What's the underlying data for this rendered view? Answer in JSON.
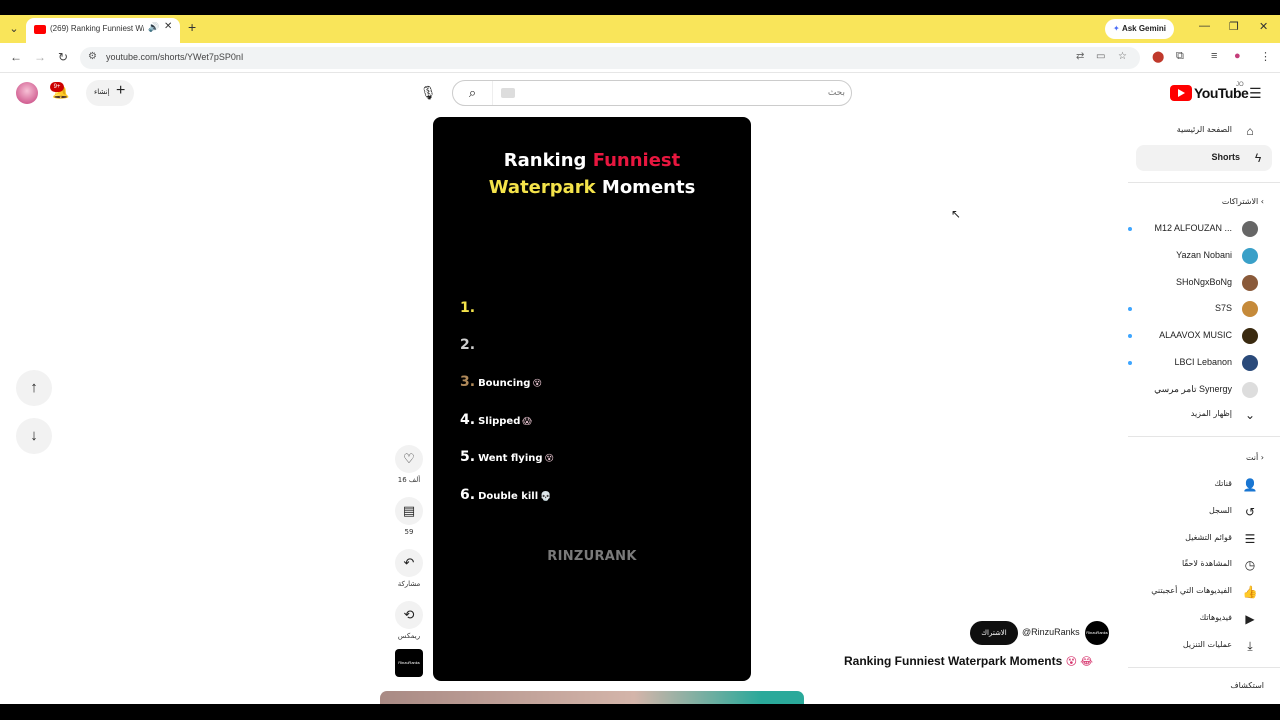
{
  "browser": {
    "tab_title": "(269) Ranking Funniest Wa",
    "url": "youtube.com/shorts/YWet7pSP0nI",
    "gemini_label": "Ask Gemini"
  },
  "masthead": {
    "logo_text": "YouTube",
    "country_code": "JO",
    "search_placeholder": "بحث",
    "create_label": "إنشاء",
    "notification_count": "9+"
  },
  "short": {
    "title_part1": "Ranking ",
    "title_red": "Funniest",
    "title_yellow": "Waterpark",
    "title_part2": " Moments",
    "ranks": [
      {
        "num": "1.",
        "text": "",
        "emoji": "",
        "color": "#f4e34a"
      },
      {
        "num": "2.",
        "text": "",
        "emoji": "",
        "color": "#cfcfcf"
      },
      {
        "num": "3.",
        "text": "Bouncing",
        "emoji": "😵",
        "color": "#b08a5a"
      },
      {
        "num": "4.",
        "text": "Slipped",
        "emoji": "😱",
        "color": "#ffffff"
      },
      {
        "num": "5.",
        "text": "Went flying",
        "emoji": "😵",
        "color": "#ffffff"
      },
      {
        "num": "6.",
        "text": "Double kill",
        "emoji": "💀",
        "color": "#ffffff"
      }
    ],
    "watermark": "RINZURANK"
  },
  "actions": {
    "likes": "16 ألف",
    "comments": "59",
    "share": "مشاركة",
    "remix": "ريمكس",
    "channel_thumb": "RinzuRanks"
  },
  "channel": {
    "handle": "@RinzuRanks",
    "subscribe_label": "الاشتراك",
    "video_title": "Ranking Funniest Waterpark Moments",
    "title_emojis": "😵 😂"
  },
  "sidebar": {
    "home": "الصفحة الرئيسية",
    "shorts": "Shorts",
    "subscriptions_header": "الاشتراكات",
    "subscriptions": [
      {
        "name": "M12 ALFOUZAN ...",
        "color": "#666666",
        "dot": true
      },
      {
        "name": "Yazan Nobani",
        "color": "#3aa0c8",
        "dot": false
      },
      {
        "name": "SHoNgxBoNg",
        "color": "#8a5a3a",
        "dot": false
      },
      {
        "name": "S7S",
        "color": "#c58a3a",
        "dot": true
      },
      {
        "name": "ALAAVOX MUSIC",
        "color": "#3a2a10",
        "dot": true
      },
      {
        "name": "LBCI Lebanon",
        "color": "#2a4a7a",
        "dot": true
      },
      {
        "name": "تامر مرسي Synergy",
        "color": "#dddddd",
        "dot": false
      }
    ],
    "show_more": "إظهار المزيد",
    "you_header": "أنت",
    "you_items": [
      {
        "label": "قناتك",
        "icon": "👤"
      },
      {
        "label": "السجل",
        "icon": "↺"
      },
      {
        "label": "قوائم التشغيل",
        "icon": "☰"
      },
      {
        "label": "المشاهدة لاحقًا",
        "icon": "◷"
      },
      {
        "label": "الفيديوهات التي أعجبتني",
        "icon": "👍"
      },
      {
        "label": "فيديوهاتك",
        "icon": "▶"
      },
      {
        "label": "عمليات التنزيل",
        "icon": "⤓"
      }
    ],
    "explore_header": "استكشاف"
  }
}
